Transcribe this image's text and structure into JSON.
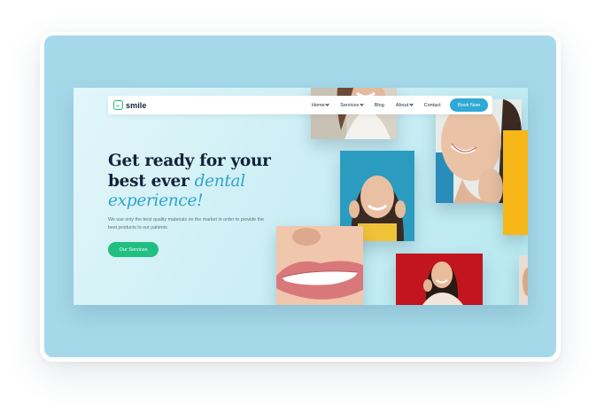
{
  "brand": {
    "name": "smile"
  },
  "nav": {
    "items": [
      {
        "label": "Home",
        "dropdown": true
      },
      {
        "label": "Services",
        "dropdown": true
      },
      {
        "label": "Blog",
        "dropdown": false
      },
      {
        "label": "About",
        "dropdown": true
      },
      {
        "label": "Contact",
        "dropdown": false
      }
    ],
    "cta_label": "Book Now"
  },
  "hero": {
    "headline_line1": "Get ready for your",
    "headline_line2_plain": "best ever ",
    "headline_line2_accent": "dental",
    "headline_line3_accent": "experience!",
    "subtext": "We use only the best quality materials on the market in order to provide the best products to our patients",
    "cta_label": "Our Services"
  },
  "colors": {
    "panel": "#a5d9e9",
    "accent_blue": "#2fa9d6",
    "accent_green": "#21bf82",
    "headline": "#13233a"
  },
  "icons": [
    "smile-logo-icon",
    "chevron-down-icon"
  ]
}
